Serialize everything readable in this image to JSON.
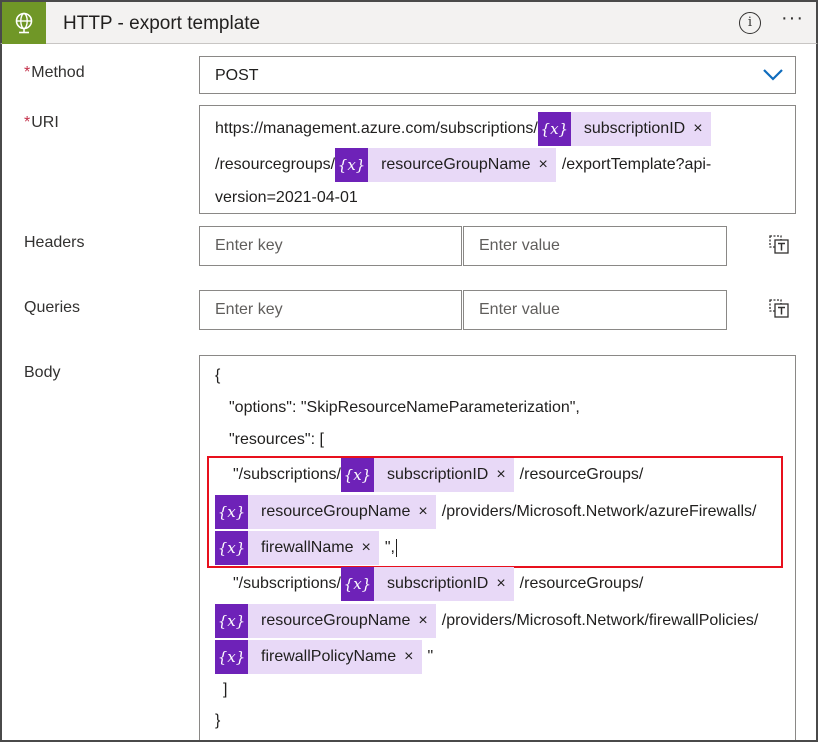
{
  "header": {
    "title": "HTTP - export template",
    "icon": "globe-icon",
    "brand_color": "#709727",
    "more_label": "···",
    "info_label": "i"
  },
  "method": {
    "label": "Method",
    "required_mark": "*",
    "value": "POST"
  },
  "uri": {
    "label": "URI",
    "required_mark": "*",
    "segments": {
      "prefix": "https://management.azure.com/subscriptions/",
      "token1": "subscriptionID",
      "mid": "/resourcegroups/",
      "token2": "resourceGroupName",
      "suffix": "/exportTemplate?api-",
      "tail": "version=2021-04-01"
    }
  },
  "headers": {
    "label": "Headers",
    "key_placeholder": "Enter key",
    "value_placeholder": "Enter value"
  },
  "queries": {
    "label": "Queries",
    "key_placeholder": "Enter key",
    "value_placeholder": "Enter value"
  },
  "body": {
    "label": "Body",
    "open_brace": "{",
    "options_line": "\"options\": \"SkipResourceNameParameterization\",",
    "resources_line": "\"resources\": [",
    "res1": {
      "prefix": "\"/subscriptions/",
      "token_sub": "subscriptionID",
      "rg_text": "/resourceGroups/",
      "token_rg": "resourceGroupName",
      "provider_text": "/providers/Microsoft.Network/azureFirewalls/",
      "token_name": "firewallName",
      "end": "\","
    },
    "res2": {
      "prefix": "\"/subscriptions/",
      "token_sub": "subscriptionID",
      "rg_text": "/resourceGroups/",
      "token_rg": "resourceGroupName",
      "provider_text": "/providers/Microsoft.Network/firewallPolicies/",
      "token_name": "firewallPolicyName",
      "end": "\""
    },
    "close_bracket": "]",
    "close_brace": "}"
  },
  "token": {
    "symbol": "{x}",
    "remove": "×",
    "color": "#6e22b8",
    "bg": "#e8d9f7"
  },
  "highlight_color": "#e8101d"
}
